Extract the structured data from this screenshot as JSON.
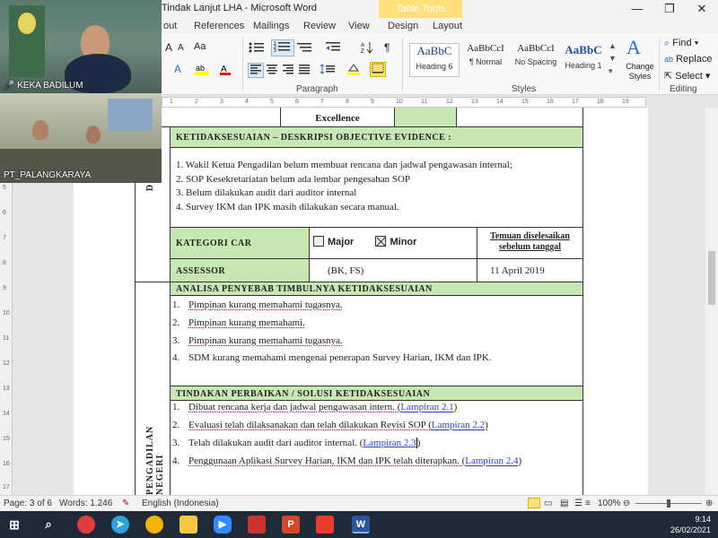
{
  "window": {
    "title": "Tindak Lanjut LHA  -  Microsoft Word",
    "context_tab_group": "Table Tools",
    "controls": {
      "minimize": "—",
      "restore": "❐",
      "close": "✕"
    }
  },
  "ribbon_tabs": [
    "out",
    "References",
    "Mailings",
    "Review",
    "View",
    "Design",
    "Layout"
  ],
  "ribbon": {
    "font_buttons": {
      "grow": "A",
      "shrink": "A",
      "case": "Aa",
      "clear": "A"
    },
    "paragraph_label": "Paragraph",
    "styles_label": "Styles",
    "editing_label": "Editing",
    "styles": [
      {
        "sample": "AaBbC",
        "name": "Heading 6"
      },
      {
        "sample": "AaBbCcI",
        "name": "¶ Normal"
      },
      {
        "sample": "AaBbCcI",
        "name": "No Spacing"
      },
      {
        "sample": "AaBbC",
        "name": "Heading 1"
      }
    ],
    "change_styles": "Change Styles",
    "find": "Find",
    "replace": "Replace",
    "select": "Select"
  },
  "ruler_marks": [
    "1",
    "2",
    "3",
    "4",
    "5",
    "6",
    "7",
    "8",
    "9",
    "10",
    "11",
    "12",
    "13",
    "14",
    "15",
    "16",
    "17",
    "18",
    "19"
  ],
  "vruler_marks": [
    "5",
    "6",
    "7",
    "8",
    "9",
    "10",
    "11",
    "12",
    "13",
    "14",
    "15",
    "16",
    "17"
  ],
  "document": {
    "excellence": "Excellence",
    "section1_header": "KETIDAKSESUAIAN  – DESKRIPSI  OBJECTIVE  EVIDENCE  :",
    "section1_side": "DI",
    "findings": [
      "1.  Wakil Ketua Pengadilan belum membuat rencana dan jadwal pengawasan internal;",
      "2.  SOP Kesekretariatan belum ada lembar pengesahan SOP",
      "3.  Belum dilakukan audit dari auditor internal",
      "4. Survey IKM dan IPK masih dilakukan secara manual."
    ],
    "kategori_label": "KATEGORI  CAR",
    "major_label": "Major",
    "minor_label": "Minor",
    "temuan_label": "Temuan diselesaikan sebelum tanggal",
    "assessor_label": "ASSESSOR",
    "assessor_value": "(BK, FS)",
    "assessor_date": "11 April 2019",
    "section2_header": "ANALISA  PENYEBAB TIMBULNYA KETIDAKSESUAIAN",
    "causes": [
      {
        "num": "1.",
        "text": "Pimpinan kurang memahami tugasnya."
      },
      {
        "num": "2.",
        "text": "Pimpinan kurang memahami."
      },
      {
        "num": "3.",
        "text": "Pimpinan kurang memahami tugasnya."
      },
      {
        "num": "4.",
        "text": "SDM kurang memahami mengenai penerapan Survey Harian, IKM dan IPK."
      }
    ],
    "section3_header": "TINDAKAN  PERBAIKAN  / SOLUSI  KETIDAKSESUAIAN",
    "side_vertical": "PENGADILAN  NEGERI",
    "actions": [
      {
        "num": "1.",
        "text": "Dibuat rencana kerja dan jadwal pengawasan intern. (",
        "link": "Lampiran 2.1",
        "end": ")"
      },
      {
        "num": "2.",
        "text": "Evaluasi telah dilaksanakan dan telah dilakukan Revisi SOP (",
        "link": "Lampiran 2.2",
        "end": ")"
      },
      {
        "num": "3.",
        "text": "Telah dilakukan audit dari auditor internal. (",
        "link": "Lampiran 2.3",
        "end": ")"
      },
      {
        "num": "4.",
        "text": "Penggunaan Aplikasi Survey Harian, IKM dan IPK telah diterapkan. (",
        "link": "Lampiran 2.4",
        "end": ")"
      }
    ]
  },
  "video": {
    "participant1": "KEKA BADILUM",
    "participant2": "PT_PALANGKARAYA"
  },
  "statusbar": {
    "page": "Page: 3 of 6",
    "words": "Words: 1.246",
    "language": "English (Indonesia)",
    "zoom": "100%",
    "zoom_level": 1.0
  },
  "taskbar": {
    "time": "9:14",
    "date": "26/02/2021"
  },
  "colors": {
    "table_green": "#c7e7b3",
    "context_tab": "#ffe07a",
    "taskbar": "#1f2a38",
    "link": "#2246c5"
  }
}
